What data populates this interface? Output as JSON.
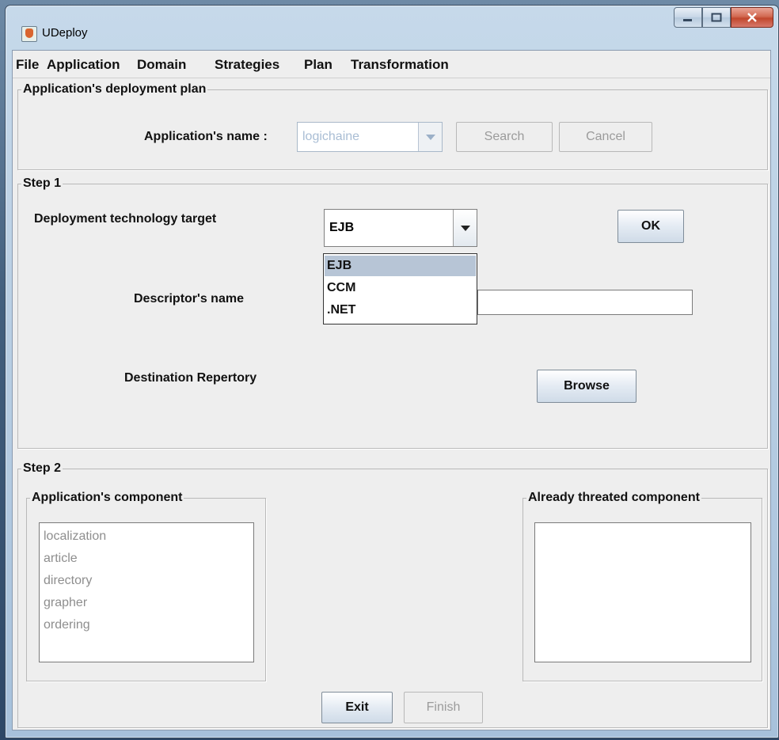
{
  "window": {
    "title": "UDeploy"
  },
  "menu": [
    "File",
    "Application",
    "Domain",
    "Strategies",
    "Plan",
    "Transformation"
  ],
  "plan_panel": {
    "legend": "Application's deployment plan",
    "app_name_label": "Application's name :",
    "app_name_value": "logichaine",
    "search_label": "Search",
    "cancel_label": "Cancel"
  },
  "step1": {
    "legend": "Step 1",
    "tech_label": "Deployment technology target",
    "tech_selected": "EJB",
    "tech_options": [
      "EJB",
      "CCM",
      ".NET"
    ],
    "ok_label": "OK",
    "descriptor_label": "Descriptor's name",
    "descriptor_value": "",
    "destination_label": "Destination Repertory",
    "browse_label": "Browse"
  },
  "step2": {
    "legend": "Step 2",
    "components_legend": "Application's component",
    "components": [
      "localization",
      "article",
      "directory",
      "grapher",
      "ordering"
    ],
    "treated_legend": "Already threated component",
    "treated": []
  },
  "buttons": {
    "exit_label": "Exit",
    "finish_label": "Finish"
  }
}
